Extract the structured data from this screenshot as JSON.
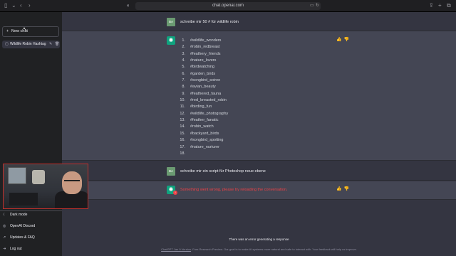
{
  "browser": {
    "url": "chat.openai.com",
    "controls": [
      "sidebar-toggle-icon",
      "chevron-down-icon",
      "back-icon",
      "forward-icon"
    ],
    "right_controls": [
      "share-icon",
      "plus-icon",
      "tabs-icon"
    ]
  },
  "sidebar": {
    "new_chat_label": "New chat",
    "history": [
      {
        "title": "Wildlife Robin Hashtag"
      }
    ],
    "bottom_items": [
      {
        "label": "Dark mode",
        "icon": "moon-icon"
      },
      {
        "label": "OpenAI Discord",
        "icon": "discord-icon"
      },
      {
        "label": "Updates & FAQ",
        "icon": "external-link-icon"
      },
      {
        "label": "Log out",
        "icon": "logout-icon"
      }
    ]
  },
  "conversation": {
    "user_avatar_label": "BA",
    "messages": [
      {
        "role": "user",
        "text": "schreibe mir 50 # für wildlife robin"
      },
      {
        "role": "assistant",
        "items": [
          "#wildlife_wonders",
          "#robin_redbreast",
          "#feathery_friends",
          "#nature_lovers",
          "#birdwatching",
          "#garden_birds",
          "#songbird_soiree",
          "#avian_beauty",
          "#feathered_fauna",
          "#red_breasted_robin",
          "#birding_fun",
          "#wildlife_photography",
          "#feather_fanatic",
          "#robin_watch",
          "#backyard_birds",
          "#songbird_spotting",
          "#nature_nurturer",
          ""
        ]
      },
      {
        "role": "user",
        "text": "schreibe mir ein script für Photoshop neue ebene"
      },
      {
        "role": "assistant",
        "error": "Something went wrong, please try reloading the conversation."
      }
    ]
  },
  "footer": {
    "error_text": "There was an error generating a response",
    "note_link": "ChatGPT Jan 9 Version",
    "note_text": ". Free Research Preview. Our goal is to make AI systems more natural and safe to interact with. Your feedback will help us improve."
  },
  "colors": {
    "sidebar_bg": "#202123",
    "main_bg": "#343541",
    "bot_bg": "#444654",
    "accent": "#10a37f",
    "error": "#ef4146"
  }
}
